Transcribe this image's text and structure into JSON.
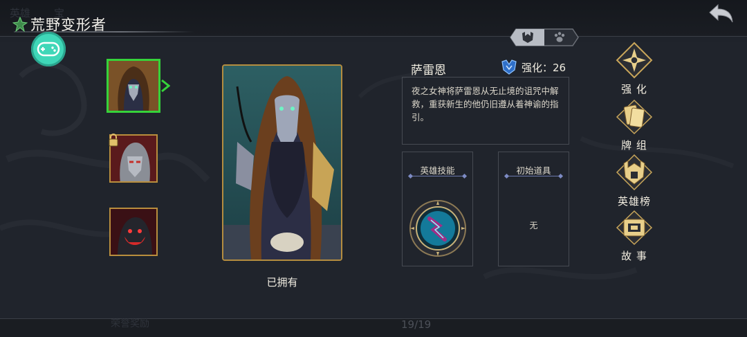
{
  "header": {
    "ghost_tabs": [
      "英雄",
      "宝"
    ],
    "title": "荒野变形者"
  },
  "heroes": [
    {
      "id": "sareion",
      "selected": true,
      "locked": false
    },
    {
      "id": "stone",
      "selected": false,
      "locked": true
    },
    {
      "id": "demon",
      "selected": false,
      "locked": false
    }
  ],
  "card": {
    "owned_label": "已拥有"
  },
  "hero_info": {
    "name": "萨雷恩",
    "upgrade_label": "强化：26",
    "description": "夜之女神将萨雷恩从无止境的诅咒中解救，重获新生的他仍旧遵从着神谕的指引。"
  },
  "panels": {
    "skill_title": "英雄技能",
    "item_title": "初始道具",
    "item_value": "无"
  },
  "side_menu": [
    {
      "label": "强 化",
      "icon": "compass-icon"
    },
    {
      "label": "牌 组",
      "icon": "cards-icon"
    },
    {
      "label": "英雄榜",
      "icon": "helmet-icon"
    },
    {
      "label": "故 事",
      "icon": "book-icon"
    }
  ],
  "footer": {
    "page_count": "19/19",
    "ghost_button": "荣誉奖励"
  },
  "colors": {
    "accent_green": "#36d33a",
    "gold": "#b98e3d",
    "gamepad": "#3fd7b8"
  }
}
